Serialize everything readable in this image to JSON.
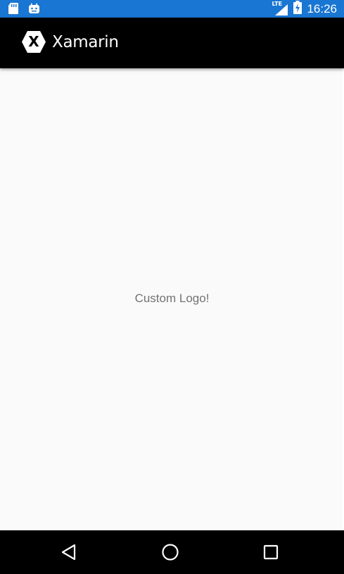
{
  "status_bar": {
    "time": "16:26",
    "network_label": "LTE",
    "icons": [
      "sd-card-icon",
      "android-debug-icon",
      "lte-signal-icon",
      "battery-charging-icon"
    ],
    "color": "#1976d2"
  },
  "app_bar": {
    "logo_text": "Xamarin",
    "logo_letter": "X",
    "color": "#000000"
  },
  "main": {
    "label": "Custom Logo!",
    "background": "#fafafa"
  },
  "nav_bar": {
    "buttons": [
      "back-icon",
      "home-icon",
      "recents-icon"
    ]
  }
}
